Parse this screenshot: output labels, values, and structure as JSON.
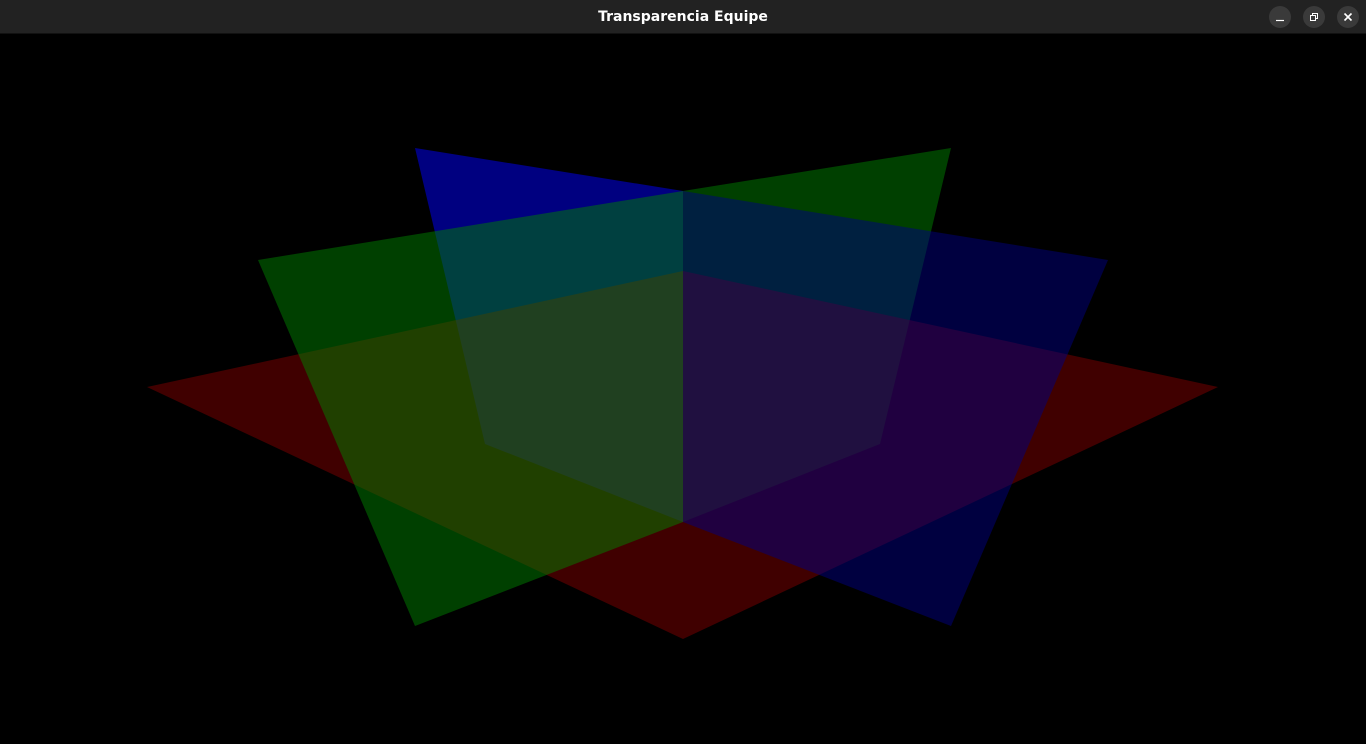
{
  "window": {
    "title": "Transparencia Equipe",
    "controls": {
      "minimize": "minimize-icon",
      "maximize": "restore-icon",
      "close": "close-icon"
    }
  },
  "scene": {
    "background": "#000000",
    "planes": [
      {
        "name": "horizontal-plane",
        "color": "#800000"
      },
      {
        "name": "diagonal-plane-a",
        "color": "#008000"
      },
      {
        "name": "diagonal-plane-b",
        "color": "#000080"
      }
    ]
  }
}
